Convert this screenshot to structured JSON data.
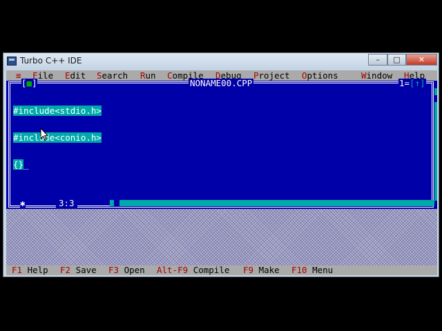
{
  "window": {
    "title": "Turbo C++ IDE",
    "controls": {
      "minimize": "–",
      "maximize": "□",
      "close": "✕"
    }
  },
  "menubar": {
    "system": "≡",
    "items": [
      {
        "label": "File",
        "hot": "F",
        "rest": "ile"
      },
      {
        "label": "Edit",
        "hot": "E",
        "rest": "dit"
      },
      {
        "label": "Search",
        "hot": "S",
        "rest": "earch"
      },
      {
        "label": "Run",
        "hot": "R",
        "rest": "un"
      },
      {
        "label": "Compile",
        "hot": "C",
        "rest": "ompile"
      },
      {
        "label": "Debug",
        "hot": "D",
        "rest": "ebug"
      },
      {
        "label": "Project",
        "hot": "P",
        "rest": "roject"
      },
      {
        "label": "Options",
        "hot": "O",
        "rest": "ptions"
      },
      {
        "label": "Window",
        "hot": "W",
        "rest": "indow"
      },
      {
        "label": "Help",
        "hot": "H",
        "rest": "elp"
      }
    ]
  },
  "editor": {
    "title": "NONAME00.CPP",
    "close_box": "[■]",
    "window_number": "1",
    "zoom_box": "[↑]",
    "lines": [
      "#include<stdio.h>",
      "#include<conio.h>",
      "{}"
    ],
    "cursor_char": "_",
    "position": "3:3",
    "bottom_mark": "✱"
  },
  "statusbar": {
    "items": [
      {
        "key": "F1",
        "label": "Help"
      },
      {
        "key": "F2",
        "label": "Save"
      },
      {
        "key": "F3",
        "label": "Open"
      },
      {
        "key": "Alt-F9",
        "label": "Compile"
      },
      {
        "key": "F9",
        "label": "Make"
      },
      {
        "key": "F10",
        "label": "Menu"
      }
    ]
  },
  "colors": {
    "editor_bg": "#0000a8",
    "menu_bg": "#aaaaaa",
    "hotkey": "#a80000",
    "selection": "#00aaaa"
  }
}
